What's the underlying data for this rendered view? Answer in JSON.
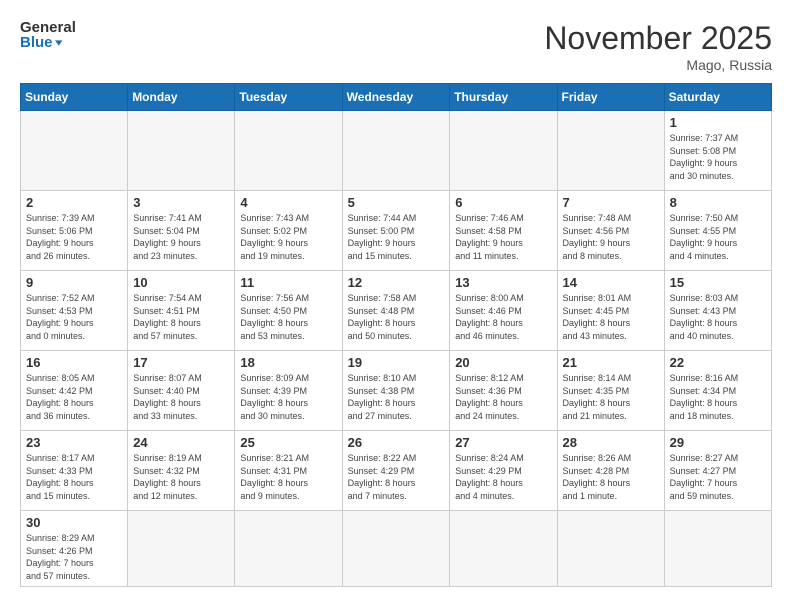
{
  "header": {
    "logo_general": "General",
    "logo_blue": "Blue",
    "month_title": "November 2025",
    "location": "Mago, Russia"
  },
  "days_of_week": [
    "Sunday",
    "Monday",
    "Tuesday",
    "Wednesday",
    "Thursday",
    "Friday",
    "Saturday"
  ],
  "weeks": [
    [
      {
        "day": "",
        "info": ""
      },
      {
        "day": "",
        "info": ""
      },
      {
        "day": "",
        "info": ""
      },
      {
        "day": "",
        "info": ""
      },
      {
        "day": "",
        "info": ""
      },
      {
        "day": "",
        "info": ""
      },
      {
        "day": "1",
        "info": "Sunrise: 7:37 AM\nSunset: 5:08 PM\nDaylight: 9 hours\nand 30 minutes."
      }
    ],
    [
      {
        "day": "2",
        "info": "Sunrise: 7:39 AM\nSunset: 5:06 PM\nDaylight: 9 hours\nand 26 minutes."
      },
      {
        "day": "3",
        "info": "Sunrise: 7:41 AM\nSunset: 5:04 PM\nDaylight: 9 hours\nand 23 minutes."
      },
      {
        "day": "4",
        "info": "Sunrise: 7:43 AM\nSunset: 5:02 PM\nDaylight: 9 hours\nand 19 minutes."
      },
      {
        "day": "5",
        "info": "Sunrise: 7:44 AM\nSunset: 5:00 PM\nDaylight: 9 hours\nand 15 minutes."
      },
      {
        "day": "6",
        "info": "Sunrise: 7:46 AM\nSunset: 4:58 PM\nDaylight: 9 hours\nand 11 minutes."
      },
      {
        "day": "7",
        "info": "Sunrise: 7:48 AM\nSunset: 4:56 PM\nDaylight: 9 hours\nand 8 minutes."
      },
      {
        "day": "8",
        "info": "Sunrise: 7:50 AM\nSunset: 4:55 PM\nDaylight: 9 hours\nand 4 minutes."
      }
    ],
    [
      {
        "day": "9",
        "info": "Sunrise: 7:52 AM\nSunset: 4:53 PM\nDaylight: 9 hours\nand 0 minutes."
      },
      {
        "day": "10",
        "info": "Sunrise: 7:54 AM\nSunset: 4:51 PM\nDaylight: 8 hours\nand 57 minutes."
      },
      {
        "day": "11",
        "info": "Sunrise: 7:56 AM\nSunset: 4:50 PM\nDaylight: 8 hours\nand 53 minutes."
      },
      {
        "day": "12",
        "info": "Sunrise: 7:58 AM\nSunset: 4:48 PM\nDaylight: 8 hours\nand 50 minutes."
      },
      {
        "day": "13",
        "info": "Sunrise: 8:00 AM\nSunset: 4:46 PM\nDaylight: 8 hours\nand 46 minutes."
      },
      {
        "day": "14",
        "info": "Sunrise: 8:01 AM\nSunset: 4:45 PM\nDaylight: 8 hours\nand 43 minutes."
      },
      {
        "day": "15",
        "info": "Sunrise: 8:03 AM\nSunset: 4:43 PM\nDaylight: 8 hours\nand 40 minutes."
      }
    ],
    [
      {
        "day": "16",
        "info": "Sunrise: 8:05 AM\nSunset: 4:42 PM\nDaylight: 8 hours\nand 36 minutes."
      },
      {
        "day": "17",
        "info": "Sunrise: 8:07 AM\nSunset: 4:40 PM\nDaylight: 8 hours\nand 33 minutes."
      },
      {
        "day": "18",
        "info": "Sunrise: 8:09 AM\nSunset: 4:39 PM\nDaylight: 8 hours\nand 30 minutes."
      },
      {
        "day": "19",
        "info": "Sunrise: 8:10 AM\nSunset: 4:38 PM\nDaylight: 8 hours\nand 27 minutes."
      },
      {
        "day": "20",
        "info": "Sunrise: 8:12 AM\nSunset: 4:36 PM\nDaylight: 8 hours\nand 24 minutes."
      },
      {
        "day": "21",
        "info": "Sunrise: 8:14 AM\nSunset: 4:35 PM\nDaylight: 8 hours\nand 21 minutes."
      },
      {
        "day": "22",
        "info": "Sunrise: 8:16 AM\nSunset: 4:34 PM\nDaylight: 8 hours\nand 18 minutes."
      }
    ],
    [
      {
        "day": "23",
        "info": "Sunrise: 8:17 AM\nSunset: 4:33 PM\nDaylight: 8 hours\nand 15 minutes."
      },
      {
        "day": "24",
        "info": "Sunrise: 8:19 AM\nSunset: 4:32 PM\nDaylight: 8 hours\nand 12 minutes."
      },
      {
        "day": "25",
        "info": "Sunrise: 8:21 AM\nSunset: 4:31 PM\nDaylight: 8 hours\nand 9 minutes."
      },
      {
        "day": "26",
        "info": "Sunrise: 8:22 AM\nSunset: 4:29 PM\nDaylight: 8 hours\nand 7 minutes."
      },
      {
        "day": "27",
        "info": "Sunrise: 8:24 AM\nSunset: 4:29 PM\nDaylight: 8 hours\nand 4 minutes."
      },
      {
        "day": "28",
        "info": "Sunrise: 8:26 AM\nSunset: 4:28 PM\nDaylight: 8 hours\nand 1 minute."
      },
      {
        "day": "29",
        "info": "Sunrise: 8:27 AM\nSunset: 4:27 PM\nDaylight: 7 hours\nand 59 minutes."
      }
    ],
    [
      {
        "day": "30",
        "info": "Sunrise: 8:29 AM\nSunset: 4:26 PM\nDaylight: 7 hours\nand 57 minutes."
      },
      {
        "day": "",
        "info": ""
      },
      {
        "day": "",
        "info": ""
      },
      {
        "day": "",
        "info": ""
      },
      {
        "day": "",
        "info": ""
      },
      {
        "day": "",
        "info": ""
      },
      {
        "day": "",
        "info": ""
      }
    ]
  ]
}
